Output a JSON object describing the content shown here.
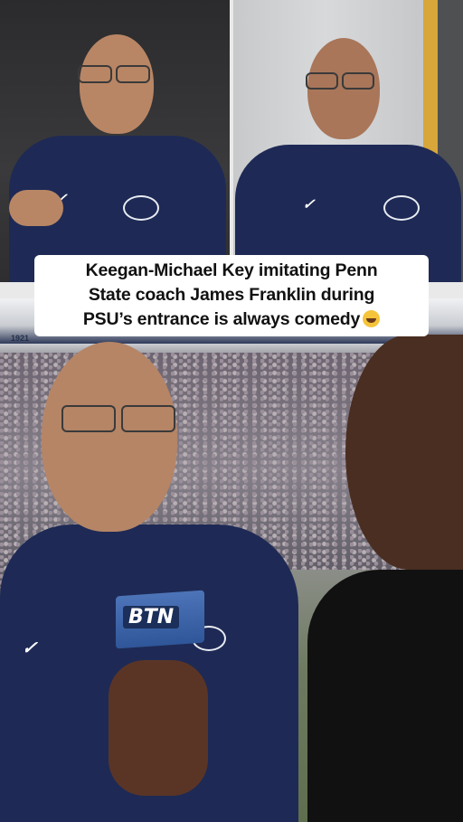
{
  "caption": {
    "line1": "Keegan-Michael Key imitating Penn",
    "line2": "State coach James Franklin during",
    "line3": "PSU’s entrance is always comedy"
  },
  "caption_emoji": "rolling-on-floor-laughing-emoji",
  "stadium": {
    "section_number": "1921"
  },
  "mic_flag": {
    "text": "BTN"
  },
  "colors": {
    "caption_background": "#ffffff",
    "caption_text": "#111111",
    "penn_state_navy": "#1e2a55",
    "btn_blue": "#3b63a8"
  }
}
